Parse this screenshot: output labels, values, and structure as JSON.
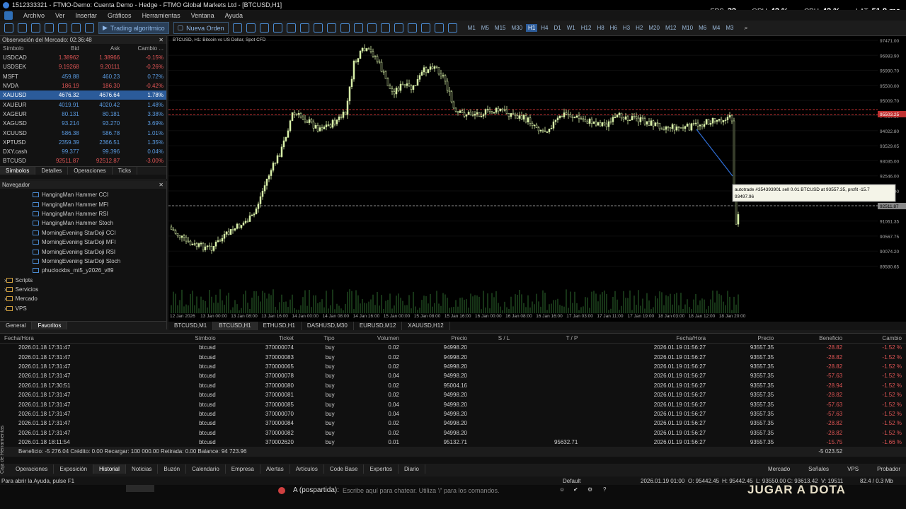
{
  "titlebar": {
    "title": "1512333321 - FTMO-Demo: Cuenta Demo - Hedge - FTMO Global Markets Ltd - [BTCUSD,H1]",
    "fps_label": "FPS",
    "fps": "32",
    "gpu_label": "GPU",
    "gpu": "42 %",
    "cpu_label": "CPU",
    "cpu": "42 %",
    "lat_label": "LAT",
    "lat": "51.8 ms"
  },
  "menu": [
    "Archivo",
    "Ver",
    "Insertar",
    "Gráficos",
    "Herramientas",
    "Ventana",
    "Ayuda"
  ],
  "toolbar": {
    "algo": "Trading algorítmico",
    "neworder": "Nueva Orden",
    "timeframes": [
      "M1",
      "M5",
      "M15",
      "M30",
      "H1",
      "H4",
      "D1",
      "W1",
      "H12",
      "H8",
      "H6",
      "H3",
      "H2",
      "M20",
      "M12",
      "M10",
      "M6",
      "M4",
      "M3"
    ],
    "active_tf": "H1"
  },
  "market": {
    "title": "Observación del Mercado: 02:36:48",
    "cols": [
      "Símbolo",
      "Bid",
      "Ask",
      "Cambio ..."
    ],
    "rows": [
      [
        "USDCAD",
        "1.38962",
        "1.38966",
        "-0.15%",
        "neg"
      ],
      [
        "USDSEK",
        "9.19268",
        "9.20111",
        "-0.26%",
        "neg"
      ],
      [
        "MSFT",
        "459.88",
        "460.23",
        "0.72%",
        "pos"
      ],
      [
        "NVDA",
        "186.19",
        "186.30",
        "-0.42%",
        "neg"
      ],
      [
        "XAUUSD",
        "4676.32",
        "4676.64",
        "1.78%",
        "sel"
      ],
      [
        "XAUEUR",
        "4019.91",
        "4020.42",
        "1.48%",
        "pos"
      ],
      [
        "XAGEUR",
        "80.131",
        "80.181",
        "3.38%",
        "pos"
      ],
      [
        "XAGUSD",
        "93.214",
        "93.270",
        "3.69%",
        "pos"
      ],
      [
        "XCUUSD",
        "586.38",
        "586.78",
        "1.01%",
        "pos"
      ],
      [
        "XPTUSD",
        "2359.39",
        "2366.51",
        "1.35%",
        "pos"
      ],
      [
        "DXY.cash",
        "99.377",
        "99.396",
        "0.04%",
        "pos"
      ],
      [
        "BTCUSD",
        "92511.87",
        "92512.87",
        "-3.00%",
        "neg"
      ]
    ],
    "tabs": [
      "Símbolos",
      "Detalles",
      "Operaciones",
      "Ticks"
    ]
  },
  "navigator": {
    "title": "Navegador",
    "items": [
      "HangingMan Hammer CCI",
      "HangingMan Hammer MFI",
      "HangingMan Hammer RSI",
      "HangingMan Hammer Stoch",
      "MorningEvening StarDoji CCI",
      "MorningEvening StarDoji MFI",
      "MorningEvening StarDoji RSI",
      "MorningEvening StarDoji Stoch",
      "phuclockbs_mt5_y2026_v89"
    ],
    "groups": [
      "Scripts",
      "Servicios",
      "Mercado",
      "VPS"
    ],
    "tabs": [
      "General",
      "Favoritos"
    ]
  },
  "chart": {
    "label": "BTCUSD, H1:  Bitcoin vs US Dollar, Spot CFD",
    "tooltip1": "autotrade #354393901 sell 0.01 BTCUSD at 93557.35, profit -15.7",
    "tooltip2": "93497.96",
    "price_tag_red": "95503.25",
    "price_tag_grey": "92511.87",
    "yticks": [
      "97471.00",
      "96983.90",
      "95990.70",
      "95500.00",
      "95009.70",
      "94516.15",
      "94022.80",
      "93529.05",
      "93035.00",
      "92546.00",
      "92048.00",
      "91554.85",
      "91061.35",
      "90567.75",
      "90074.20",
      "89580.65"
    ],
    "xticks": [
      "12 Jan 2026",
      "13 Jan 00:00",
      "13 Jan 08:00",
      "13 Jan 16:00",
      "14 Jan 00:00",
      "14 Jan 08:00",
      "14 Jan 16:00",
      "15 Jan 00:00",
      "15 Jan 08:00",
      "15 Jan 16:00",
      "16 Jan 00:00",
      "16 Jan 08:00",
      "16 Jan 16:00",
      "17 Jan 03:00",
      "17 Jan 11:00",
      "17 Jan 19:00",
      "18 Jan 03:00",
      "18 Jan 12:00",
      "18 Jan 20:00"
    ]
  },
  "charttabs": [
    "BTCUSD,M1",
    "BTCUSD,H1",
    "ETHUSD,H1",
    "DASHUSD,M30",
    "EURUSD,M12",
    "XAUUSD,H12"
  ],
  "trades": {
    "cols": [
      "Fecha/Hora",
      "Símbolo",
      "Ticket",
      "Tipo",
      "Volumen",
      "Precio",
      "S / L",
      "T / P",
      "Fecha/Hora",
      "Precio",
      "Beneficio",
      "Cambio"
    ],
    "rows": [
      [
        "2026.01.18 17:31:47",
        "btcusd",
        "370000074",
        "buy",
        "0.02",
        "94998.20",
        "",
        "",
        "2026.01.19 01:56:27",
        "93557.35",
        "-28.82",
        "-1.52 %"
      ],
      [
        "2026.01.18 17:31:47",
        "btcusd",
        "370000083",
        "buy",
        "0.02",
        "94998.20",
        "",
        "",
        "2026.01.19 01:56:27",
        "93557.35",
        "-28.82",
        "-1.52 %"
      ],
      [
        "2026.01.18 17:31:47",
        "btcusd",
        "370000065",
        "buy",
        "0.02",
        "94998.20",
        "",
        "",
        "2026.01.19 01:56:27",
        "93557.35",
        "-28.82",
        "-1.52 %"
      ],
      [
        "2026.01.18 17:31:47",
        "btcusd",
        "370000078",
        "buy",
        "0.04",
        "94998.20",
        "",
        "",
        "2026.01.19 01:56:27",
        "93557.35",
        "-57.63",
        "-1.52 %"
      ],
      [
        "2026.01.18 17:30:51",
        "btcusd",
        "370000080",
        "buy",
        "0.02",
        "95004.16",
        "",
        "",
        "2026.01.19 01:56:27",
        "93557.35",
        "-28.94",
        "-1.52 %"
      ],
      [
        "2026.01.18 17:31:47",
        "btcusd",
        "370000081",
        "buy",
        "0.02",
        "94998.20",
        "",
        "",
        "2026.01.19 01:56:27",
        "93557.35",
        "-28.82",
        "-1.52 %"
      ],
      [
        "2026.01.18 17:31:47",
        "btcusd",
        "370000085",
        "buy",
        "0.04",
        "94998.20",
        "",
        "",
        "2026.01.19 01:56:27",
        "93557.35",
        "-57.63",
        "-1.52 %"
      ],
      [
        "2026.01.18 17:31:47",
        "btcusd",
        "370000070",
        "buy",
        "0.04",
        "94998.20",
        "",
        "",
        "2026.01.19 01:56:27",
        "93557.35",
        "-57.63",
        "-1.52 %"
      ],
      [
        "2026.01.18 17:31:47",
        "btcusd",
        "370000084",
        "buy",
        "0.02",
        "94998.20",
        "",
        "",
        "2026.01.19 01:56:27",
        "93557.35",
        "-28.82",
        "-1.52 %"
      ],
      [
        "2026.01.18 17:31:47",
        "btcusd",
        "370000082",
        "buy",
        "0.02",
        "94998.20",
        "",
        "",
        "2026.01.19 01:56:27",
        "93557.35",
        "-28.82",
        "-1.52 %"
      ],
      [
        "2026.01.18 18:11:54",
        "btcusd",
        "370002620",
        "buy",
        "0.01",
        "95132.71",
        "",
        "95632.71",
        "2026.01.19 01:56:27",
        "93557.35",
        "-15.75",
        "-1.66 %"
      ]
    ],
    "summary": "Beneficio: -5 276.04  Crédito: 0.00  Recargar: 100 000.00  Retirada: 0.00  Balance: 94 723.96",
    "summary_total": "-5 023.52"
  },
  "bottomtabs": [
    "Operaciones",
    "Exposición",
    "Historial",
    "Noticias",
    "Buzón",
    "Calendario",
    "Empresa",
    "Alertas",
    "Artículos",
    "Code Base",
    "Expertos",
    "Diario"
  ],
  "bottomright": [
    "Mercado",
    "Señales",
    "VPS",
    "Probador"
  ],
  "sidelabel": "Caja de Herramientas",
  "status": {
    "help": "Para abrir la Ayuda, pulse F1",
    "profile": "Default",
    "time": "2026.01.19 01:00",
    "open": "O: 95442.45",
    "high": "H: 95442.45",
    "low": "L: 93550.00",
    "close": "C: 93613.42",
    "vol": "V: 19511",
    "net": "82.4 / 0.3 Mb"
  },
  "chatbar": {
    "user": "A (pospartida):",
    "placeholder": "Escribe aquí para chatear. Utiliza '/' para los comandos.",
    "overlay": "JUGAR A DOTA"
  }
}
